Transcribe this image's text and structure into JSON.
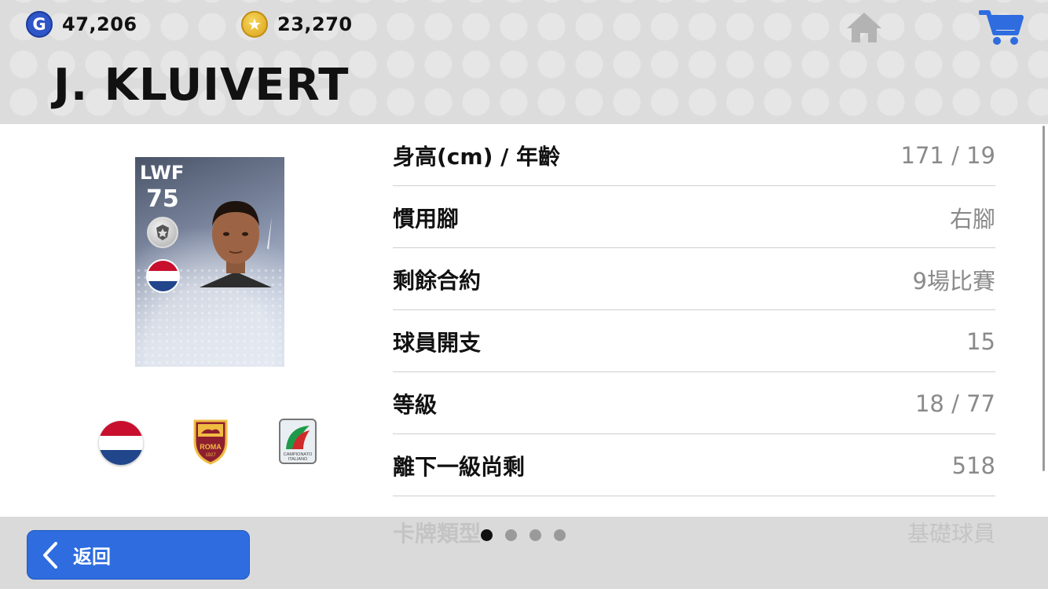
{
  "header": {
    "gp_icon_letter": "G",
    "gp_amount": "47,206",
    "coin_icon": "star-coin-icon",
    "coin_amount": "23,270",
    "player_name": "J. KLUIVERT"
  },
  "card": {
    "position": "LWF",
    "rating": "75"
  },
  "stats": [
    {
      "label": "身高(cm) / 年齡",
      "value": "171 / 19"
    },
    {
      "label": "慣用腳",
      "value": "右腳"
    },
    {
      "label": "剩餘合約",
      "value": "9場比賽"
    },
    {
      "label": "球員開支",
      "value": "15"
    },
    {
      "label": "等級",
      "value": "18 / 77"
    },
    {
      "label": "離下一級尚剩",
      "value": "518"
    }
  ],
  "peek_row": {
    "label": "卡牌類型",
    "value": "基礎球員"
  },
  "club_crest": {
    "text": "ROMA",
    "year": "1927"
  },
  "league_logo": {
    "line1": "CAMPIONATO",
    "line2": "ITALIANO"
  },
  "footer": {
    "back_label": "返回",
    "page_count": 4,
    "active_page": 1
  },
  "colors": {
    "accent": "#2e6cdf",
    "header_bg": "#dcdcdc",
    "value_gray": "#8a8a8a"
  }
}
